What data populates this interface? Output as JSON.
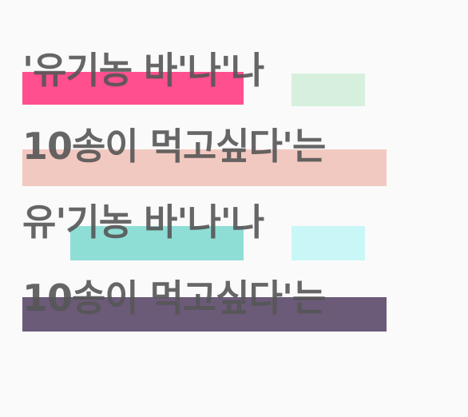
{
  "lines": [
    "'유기농 바'나'나",
    "10송이 먹고싶다'는",
    "유'기농 바'나'나",
    "10송이 먹고싶다'는"
  ],
  "colors": {
    "background": "#fafafa",
    "text": "#555555",
    "highlight_pink": "#ff4f8f",
    "highlight_mint_light": "#d6f0dd",
    "highlight_salmon": "#f2c9c0",
    "highlight_teal": "#8fded6",
    "highlight_cyan_light": "#c9f7f7",
    "highlight_purple": "#6c5a79"
  }
}
